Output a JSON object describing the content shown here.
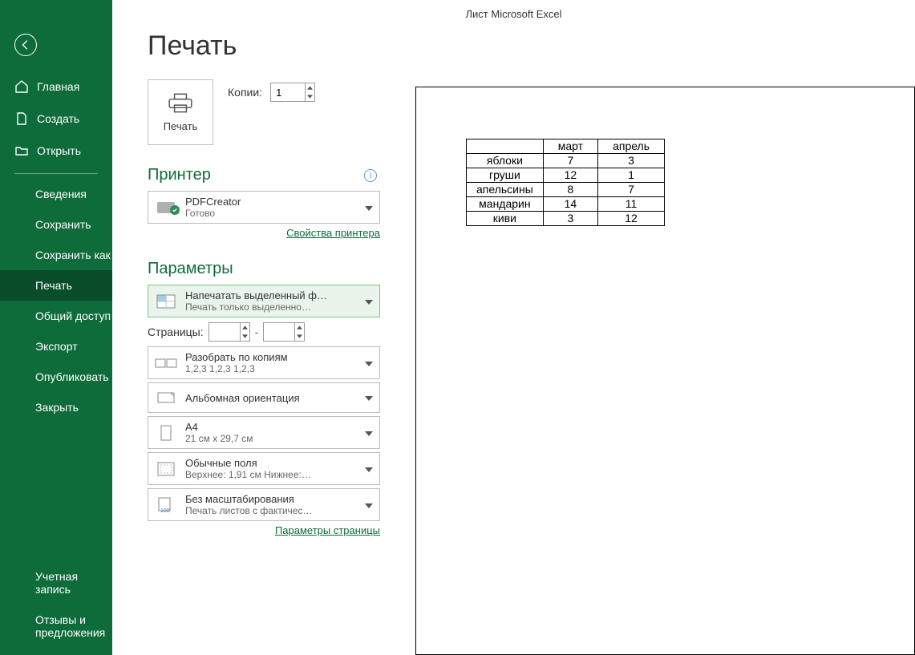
{
  "app_title": "Лист Microsoft Excel",
  "sidebar": {
    "home": "Главная",
    "new": "Создать",
    "open": "Открыть",
    "info": "Сведения",
    "save": "Сохранить",
    "saveas": "Сохранить как",
    "print": "Печать",
    "share": "Общий доступ",
    "export": "Экспорт",
    "publish": "Опубликовать",
    "close": "Закрыть",
    "account": "Учетная запись",
    "feedback": "Отзывы и предложения"
  },
  "print": {
    "heading": "Печать",
    "print_button": "Печать",
    "copies_label": "Копии:",
    "copies_value": "1",
    "printer_heading": "Принтер",
    "printer_name": "PDFCreator",
    "printer_status": "Готово",
    "printer_props_link": "Свойства принтера",
    "settings_heading": "Параметры",
    "scope_title": "Напечатать выделенный ф…",
    "scope_sub": "Печать только выделенно…",
    "pages_label": "Страницы:",
    "collate_title": "Разобрать по копиям",
    "collate_sub": "1,2,3    1,2,3    1,2,3",
    "orientation_title": "Альбомная ориентация",
    "paper_title": "A4",
    "paper_sub": "21 см x 29,7 см",
    "margins_title": "Обычные поля",
    "margins_sub": "Верхнее: 1,91 см Нижнее:…",
    "scaling_title": "Без масштабирования",
    "scaling_sub": "Печать листов с фактичес…",
    "page_setup_link": "Параметры страницы"
  },
  "chart_data": {
    "type": "table",
    "title": "",
    "columns": [
      "",
      "март",
      "апрель"
    ],
    "rows": [
      [
        "яблоки",
        7,
        3
      ],
      [
        "груши",
        12,
        1
      ],
      [
        "апельсины",
        8,
        7
      ],
      [
        "мандарин",
        14,
        11
      ],
      [
        "киви",
        3,
        12
      ]
    ]
  }
}
